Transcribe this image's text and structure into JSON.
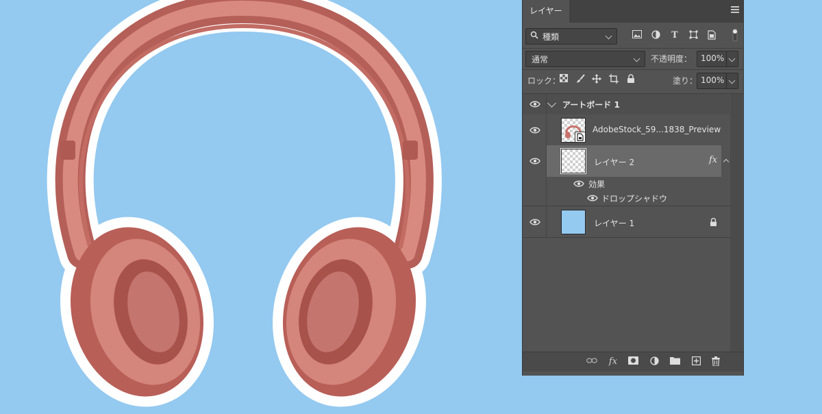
{
  "panel": {
    "tab_label": "レイヤー",
    "filter": {
      "selected": "種類",
      "icon": "search-icon"
    },
    "filter_icons": [
      "image-filter-icon",
      "adjustment-filter-icon",
      "type-filter-icon",
      "shape-filter-icon",
      "smart-object-filter-icon"
    ],
    "blend_mode": {
      "selected": "通常"
    },
    "opacity": {
      "label": "不透明度：",
      "value": "100%"
    },
    "lock": {
      "label": "ロック："
    },
    "fill": {
      "label": "塗り：",
      "value": "100%"
    },
    "layers": [
      {
        "name": "アートボード 1",
        "type": "artboard",
        "visible": true
      },
      {
        "name": "AdobeStock_59...1838_Preview",
        "type": "smart-object",
        "visible": true
      },
      {
        "name": "レイヤー 2",
        "type": "pixel",
        "visible": true,
        "fx": "fx",
        "selected": true
      },
      {
        "name": "効果",
        "type": "effects-group",
        "visible": true
      },
      {
        "name": "ドロップシャドウ",
        "type": "effect",
        "visible": true
      },
      {
        "name": "レイヤー 1",
        "type": "pixel",
        "visible": true,
        "locked": true,
        "thumb_color": "#94c9f0"
      }
    ]
  },
  "colors": {
    "canvas_background": "#94c9f0",
    "headphones": "#c9726a",
    "panel_background": "#535353",
    "selected_row": "#6a6a6a"
  }
}
